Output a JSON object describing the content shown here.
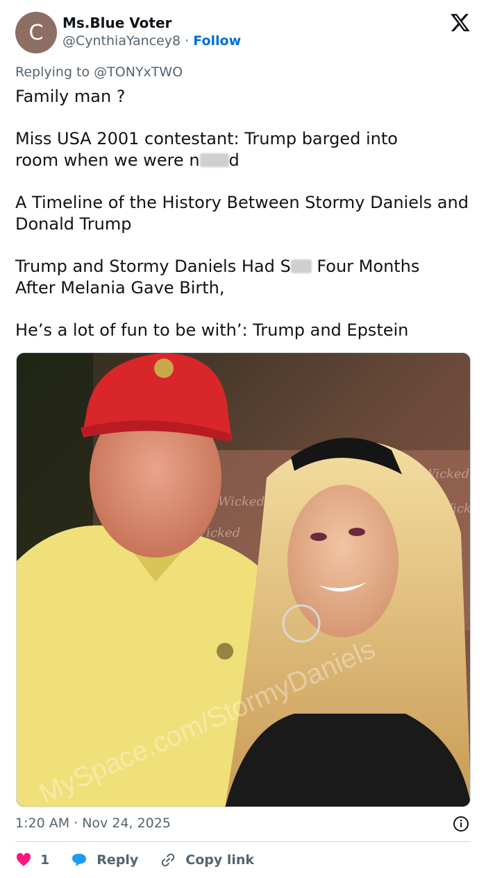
{
  "author": {
    "avatar_letter": "C",
    "name": "Ms.Blue Voter",
    "handle": "@CynthiaYancey8",
    "separator": "·",
    "follow_label": "Follow"
  },
  "reply": {
    "prefix": "Replying to",
    "mention": "@TONYxTWO"
  },
  "post": {
    "line1": "Family man ?",
    "line2a": "Miss USA 2001 contestant: Trump barged into",
    "line2b_pre": "room when we were n",
    "line2b_post": "d",
    "line3": "A Timeline of the History Between Stormy Daniels and Donald Trump",
    "line4_pre": "Trump and Stormy Daniels Had S",
    "line4_post": " Four Months",
    "line4b": "After Melania Gave Birth,",
    "line5": "He’s a lot of fun to be with’: Trump and Epstein"
  },
  "image": {
    "watermark": "MySpace.com/StormyDaniels",
    "backdrop_text": "Wicked"
  },
  "meta": {
    "timestamp": "1:20 AM · Nov 24, 2025"
  },
  "actions": {
    "like_count": "1",
    "reply_label": "Reply",
    "copy_label": "Copy link"
  },
  "colors": {
    "follow": "#006fd6",
    "like": "#f91880",
    "reply_icon": "#1d9bf0",
    "muted": "#536471"
  }
}
